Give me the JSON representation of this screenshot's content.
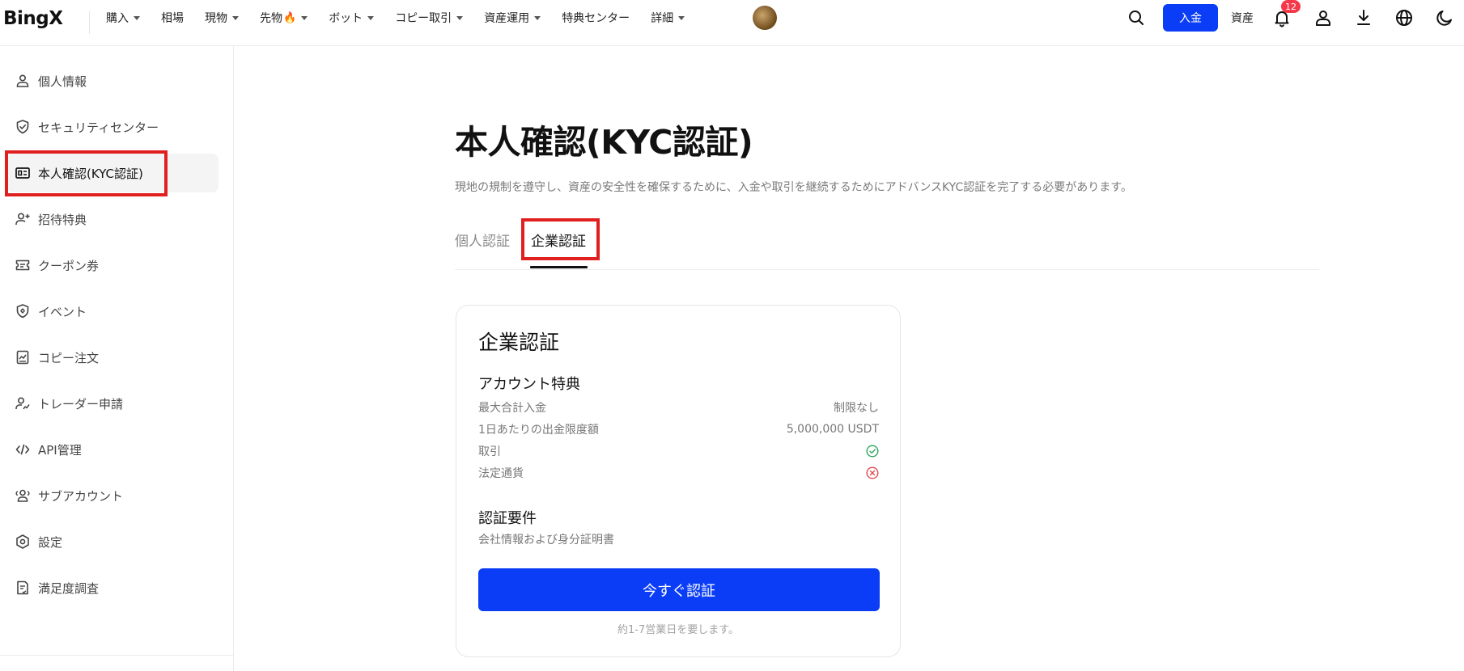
{
  "header": {
    "logo": "BingX",
    "nav": [
      {
        "label": "購入",
        "has_caret": true
      },
      {
        "label": "相場",
        "has_caret": false
      },
      {
        "label": "現物",
        "has_caret": true
      },
      {
        "label": "先物",
        "has_caret": true,
        "emoji": "🔥"
      },
      {
        "label": "ボット",
        "has_caret": true
      },
      {
        "label": "コピー取引",
        "has_caret": true
      },
      {
        "label": "資産運用",
        "has_caret": true
      },
      {
        "label": "特典センター",
        "has_caret": false
      },
      {
        "label": "詳細",
        "has_caret": true
      }
    ],
    "deposit_label": "入金",
    "assets_label": "資産",
    "notification_count": "12",
    "icons": [
      "search-icon",
      "bell-icon",
      "user-icon",
      "download-icon",
      "globe-icon",
      "moon-icon"
    ]
  },
  "sidebar": {
    "items": [
      {
        "label": "個人情報",
        "icon": "person-icon"
      },
      {
        "label": "セキュリティセンター",
        "icon": "shield-icon"
      },
      {
        "label": "本人確認(KYC認証)",
        "icon": "id-card-icon",
        "active": true
      },
      {
        "label": "招待特典",
        "icon": "person-plus-icon"
      },
      {
        "label": "クーポン券",
        "icon": "ticket-icon"
      },
      {
        "label": "イベント",
        "icon": "event-icon"
      },
      {
        "label": "コピー注文",
        "icon": "copy-order-icon"
      },
      {
        "label": "トレーダー申請",
        "icon": "trader-icon"
      },
      {
        "label": "API管理",
        "icon": "code-icon"
      },
      {
        "label": "サブアカウント",
        "icon": "group-icon"
      },
      {
        "label": "設定",
        "icon": "hexagon-gear-icon"
      },
      {
        "label": "満足度調査",
        "icon": "survey-icon"
      }
    ]
  },
  "main": {
    "title": "本人確認(KYC認証)",
    "description": "現地の規制を遵守し、資産の安全性を確保するために、入金や取引を継続するためにアドバンスKYC認証を完了する必要があります。",
    "tabs": [
      {
        "label": "個人認証",
        "active": false
      },
      {
        "label": "企業認証",
        "active": true
      }
    ],
    "card": {
      "title": "企業認証",
      "benefits_title": "アカウント特典",
      "rows": [
        {
          "label": "最大合計入金",
          "value": "制限なし"
        },
        {
          "label": "1日あたりの出金限度額",
          "value": "5,000,000 USDT"
        },
        {
          "label": "取引",
          "status": "check"
        },
        {
          "label": "法定通貨",
          "status": "cross"
        }
      ],
      "requirements_title": "認証要件",
      "requirements_text": "会社情報および身分証明書",
      "button_label": "今すぐ認証",
      "note": "約1-7営業日を要します。"
    }
  },
  "colors": {
    "primary": "#0a3df5",
    "highlight": "#e02020",
    "success": "#2aa65a",
    "danger": "#e5484d",
    "badge": "#f5394a"
  }
}
